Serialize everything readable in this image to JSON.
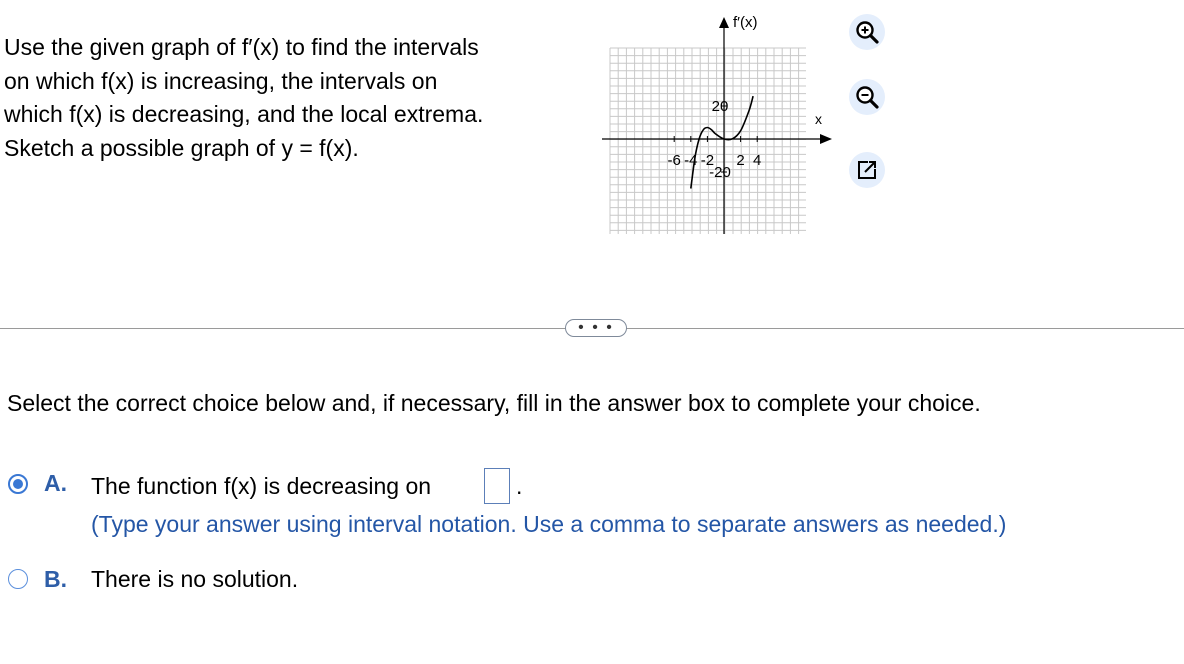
{
  "question": {
    "lines": [
      "Use the given graph of f′(x) to find the intervals",
      "on which f(x) is increasing, the intervals on",
      "which f(x) is decreasing, and the local extrema.",
      "Sketch a possible graph of y = f(x)."
    ]
  },
  "graph": {
    "y_axis_label": "f′(x)",
    "x_axis_label": "x",
    "x_tick_labels": [
      "-6",
      "-4",
      "-2",
      "2",
      "4"
    ],
    "y_tick_labels": [
      "20",
      "-20"
    ]
  },
  "chart_data": {
    "type": "line",
    "title": "",
    "xlabel": "x",
    "ylabel": "f′(x)",
    "xlim": [
      -7,
      6
    ],
    "ylim": [
      -30,
      30
    ],
    "grid": true,
    "x_ticks": [
      -6,
      -4,
      -2,
      2,
      4
    ],
    "y_ticks": [
      20,
      -20
    ],
    "series": [
      {
        "x": [
          -4,
          -3.5,
          -3,
          -2.5,
          -2,
          -1.5,
          -1,
          0,
          1,
          2,
          3,
          3.5
        ],
        "y": [
          -30,
          -11.4,
          0,
          5.6,
          7,
          5.6,
          3,
          0,
          0.1,
          5,
          17,
          26
        ]
      }
    ]
  },
  "tools": {
    "zoom_in": "zoom-in-icon",
    "zoom_out": "zoom-out-icon",
    "expand": "expand-icon"
  },
  "more_button": "• • •",
  "instruction": "Select the correct choice below and, if necessary, fill in the answer box to complete your choice.",
  "choices": {
    "a": {
      "letter": "A.",
      "text": "The function f(x) is decreasing on",
      "answer_value": "",
      "period": ".",
      "hint": "(Type your answer using interval notation. Use a comma to separate answers as needed.)",
      "selected": true
    },
    "b": {
      "letter": "B.",
      "text": "There is no solution.",
      "selected": false
    }
  },
  "colors": {
    "accent": "#3a78d4",
    "hint_text": "#2456a6",
    "choice_letter": "#2e5ea8",
    "tool_bg": "#e4eefc"
  }
}
